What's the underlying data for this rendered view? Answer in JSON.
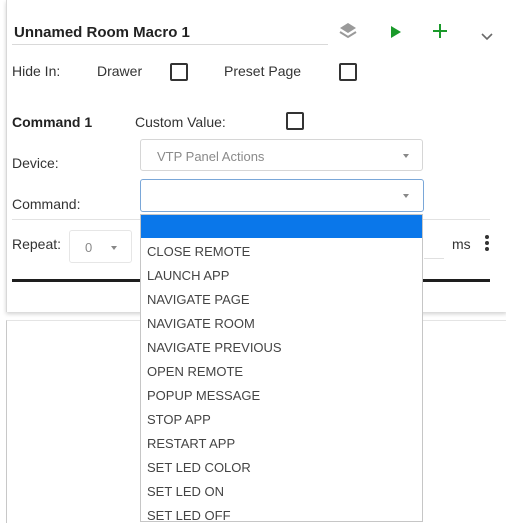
{
  "macro": {
    "title": "Unnamed Room Macro 1",
    "hide_in_label": "Hide In:",
    "drawer_label": "Drawer",
    "preset_page_label": "Preset Page"
  },
  "toolbar_icons": [
    "layers-icon",
    "play-icon",
    "plus-icon",
    "chevron-down-icon"
  ],
  "colors": {
    "accent": "#0a77ea",
    "play": "#1a9a2a",
    "add": "#1a9a2a"
  },
  "command": {
    "heading": "Command 1",
    "custom_value_label": "Custom Value:",
    "device_label": "Device:",
    "device_value": "VTP Panel Actions",
    "command_label": "Command:",
    "command_value": "",
    "repeat_label": "Repeat:",
    "repeat_value": "0",
    "ms_label": "ms"
  },
  "command_options": [
    "CLOSE REMOTE",
    "LAUNCH APP",
    "NAVIGATE PAGE",
    "NAVIGATE ROOM",
    "NAVIGATE PREVIOUS",
    "OPEN REMOTE",
    "POPUP MESSAGE",
    "STOP APP",
    "RESTART APP",
    "SET LED COLOR",
    "SET LED ON",
    "SET LED OFF"
  ]
}
